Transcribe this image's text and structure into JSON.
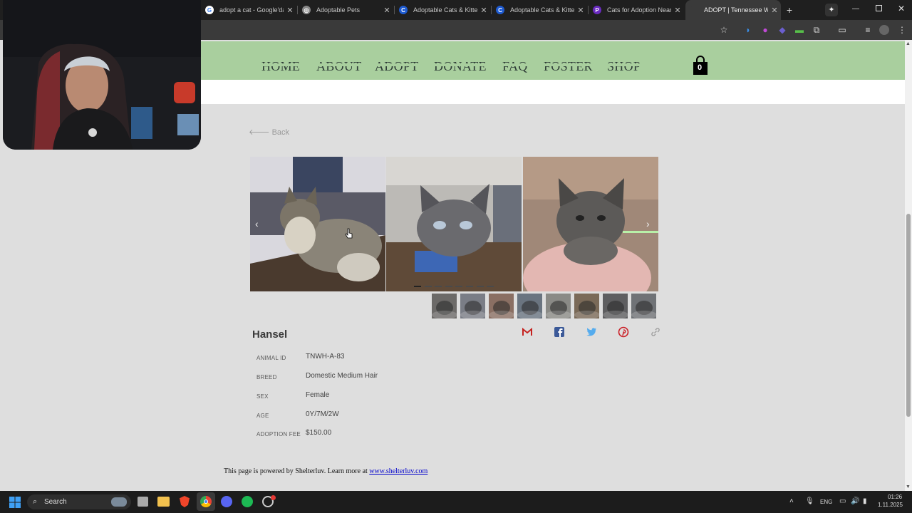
{
  "browser": {
    "tabs": [
      {
        "title": "adopt a cat - Google'da Ara",
        "favicon": "G",
        "color": "#ffffff"
      },
      {
        "title": "Adoptable Pets",
        "favicon": "◎",
        "color": "#888888"
      },
      {
        "title": "Adoptable Cats & Kittens",
        "favicon": "C",
        "color": "#1e5bd1"
      },
      {
        "title": "Adoptable Cats & Kittens",
        "favicon": "C",
        "color": "#1e5bd1"
      },
      {
        "title": "Cats for Adoption Near Me",
        "favicon": "P",
        "color": "#6a2bc0"
      },
      {
        "title": "ADOPT | Tennessee Whiskers",
        "favicon": "",
        "color": "#3a3a3a"
      }
    ],
    "new_tab": "+"
  },
  "site": {
    "nav": [
      "HOME",
      "ABOUT",
      "ADOPT",
      "DONATE",
      "FAQ",
      "FOSTER",
      "SHOP"
    ],
    "cart_count": "0",
    "back_label": "Back",
    "accent_color": "#a9cf9e"
  },
  "pet": {
    "name": "Hansel",
    "fields": [
      {
        "label": "ANIMAL ID",
        "value": "TNWH-A-83"
      },
      {
        "label": "BREED",
        "value": "Domestic Medium Hair"
      },
      {
        "label": "SEX",
        "value": "Female"
      },
      {
        "label": "AGE",
        "value": "0Y/7M/2W"
      },
      {
        "label": "ADOPTION FEE",
        "value": "$150.00"
      }
    ],
    "photo_count": 8,
    "share_icons": [
      "gmail-icon",
      "facebook-icon",
      "twitter-icon",
      "pinterest-icon",
      "link-icon"
    ]
  },
  "footer": {
    "text": "This page is powered by Shelterluv. Learn more at ",
    "link": "www.shelterluv.com"
  },
  "taskbar": {
    "search_label": "Search",
    "lang": "ENG",
    "time": "01:26",
    "date": "1.11.2025"
  }
}
